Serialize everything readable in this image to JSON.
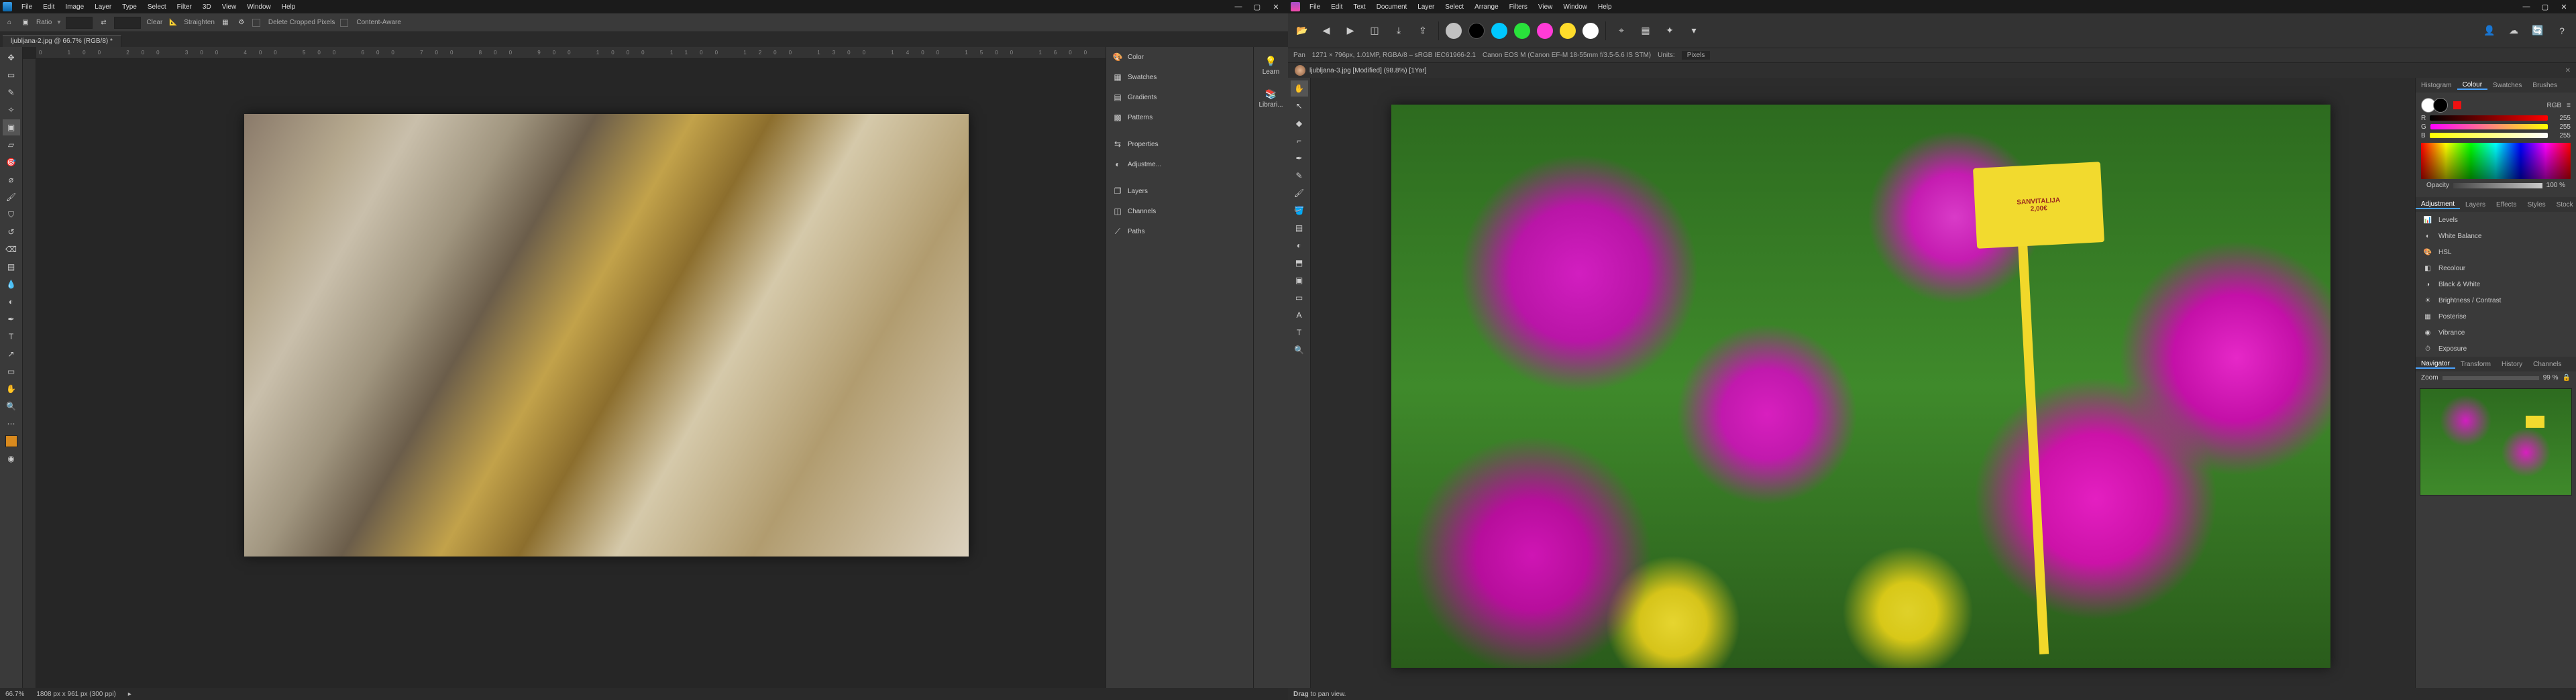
{
  "photoshop": {
    "menus": [
      "File",
      "Edit",
      "Image",
      "Layer",
      "Type",
      "Select",
      "Filter",
      "3D",
      "View",
      "Window",
      "Help"
    ],
    "window_controls": {
      "minimize": "—",
      "maximize": "▢",
      "close": "✕"
    },
    "options_bar": {
      "home_icon": "home-icon",
      "crop_icon": "crop-icon",
      "ratio_label": "Ratio",
      "ratio_w": "",
      "swap": "⇄",
      "ratio_h": "",
      "clear": "Clear",
      "straighten": "Straighten",
      "grid_icon": "grid-icon",
      "gear_icon": "gear-icon",
      "delete_cropped": "Delete Cropped Pixels",
      "content_aware": "Content-Aware"
    },
    "tab": "ljubljana-2.jpg @ 66.7% (RGB/8) *",
    "tools": [
      "move",
      "marquee",
      "lasso",
      "wand",
      "crop",
      "frame",
      "eyedrop",
      "patch",
      "brush",
      "stamp",
      "history",
      "eraser",
      "gradient",
      "blur",
      "dodge",
      "pen",
      "type",
      "path",
      "rect",
      "hand",
      "zoom",
      "ellipsis",
      "fg-bg",
      "qmask"
    ],
    "panels_right": {
      "color": "Color",
      "swatches": "Swatches",
      "gradients": "Gradients",
      "patterns": "Patterns",
      "properties": "Properties",
      "adjustments": "Adjustme...",
      "layers": "Layers",
      "channels": "Channels",
      "paths": "Paths"
    },
    "aux": {
      "learn": "Learn",
      "libraries": "Librari..."
    },
    "status": {
      "zoom": "66.7%",
      "doc": "1808 px x 961 px (300 ppi)"
    }
  },
  "affinity": {
    "menus": [
      "File",
      "Edit",
      "Text",
      "Document",
      "Layer",
      "Select",
      "Arrange",
      "Filters",
      "View",
      "Window",
      "Help"
    ],
    "window_controls": {
      "minimize": "—",
      "maximize": "▢",
      "close": "✕"
    },
    "toolbar": {
      "icons": [
        "open",
        "back",
        "fwd",
        "split",
        "fit",
        "export",
        "share"
      ],
      "ring_colors": [
        "#c1c1c1",
        "#000000",
        "#00c8ff",
        "#29e23b",
        "#ff3bd7",
        "#ffdc2b",
        "#ffffff"
      ],
      "snapping": "snap",
      "grid": "grid",
      "misc": "misc",
      "right_icons": [
        "account",
        "cloud",
        "sync",
        "help"
      ]
    },
    "context_row": {
      "tool": "Pan",
      "dims": "1271 × 796px, 1.01MP, RGBA/8 – sRGB IEC61966-2.1",
      "camera": "Canon EOS M (Canon EF-M 18-55mm f/3.5-5.6 IS STM)",
      "units_label": "Units:",
      "units_value": "Pixels"
    },
    "tab": "ljubljana-3.jpg [Modified] (98.8%) [1Yar]",
    "tools": [
      "pan",
      "move",
      "node",
      "corner",
      "pen",
      "pencil",
      "vbrush",
      "fill",
      "gradient",
      "transparency",
      "place",
      "crop",
      "shapes",
      "text",
      "ftext",
      "zoom"
    ],
    "right_panel": {
      "tabs_top": [
        "Histogram",
        "Colour",
        "Swatches",
        "Brushes"
      ],
      "tabs_top_active": "Colour",
      "mode": "RGB",
      "r": 255,
      "g": 255,
      "b": 255,
      "opacity_label": "Opacity",
      "opacity": "100 %",
      "tabs_adj": [
        "Adjustment",
        "Layers",
        "Effects",
        "Styles",
        "Stock"
      ],
      "tabs_adj_active": "Adjustment",
      "adjustments": [
        "Levels",
        "White Balance",
        "HSL",
        "Recolour",
        "Black & White",
        "Brightness / Contrast",
        "Posterise",
        "Vibrance",
        "Exposure"
      ],
      "tabs_nav": [
        "Navigator",
        "Transform",
        "History",
        "Channels"
      ],
      "tabs_nav_active": "Navigator",
      "zoom_label": "Zoom",
      "zoom_value": "99 %"
    },
    "status": {
      "drag": "Drag",
      "hint": "to pan view."
    },
    "sign_line1": "SANVITALIJA",
    "sign_line2": "2,00€"
  }
}
